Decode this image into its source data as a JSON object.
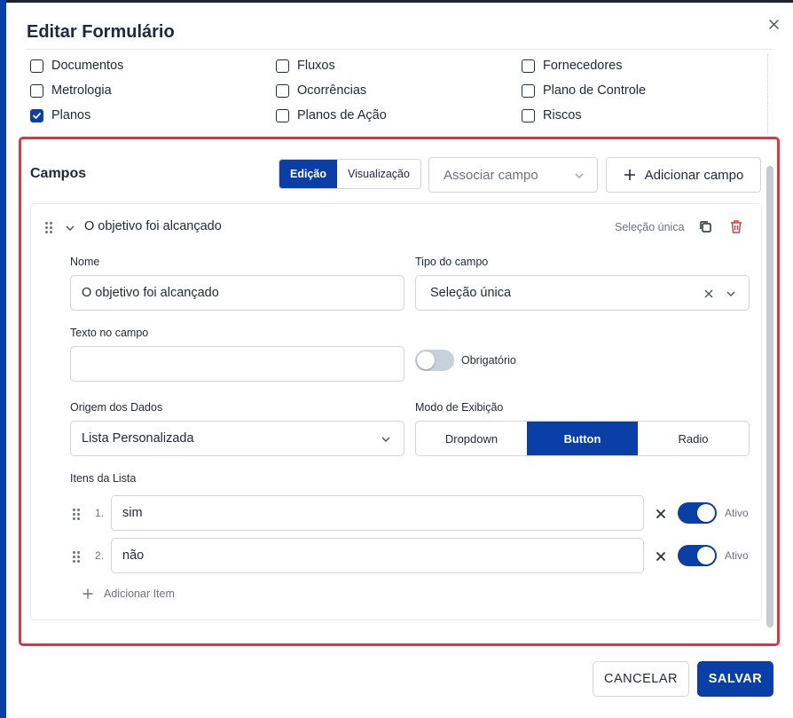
{
  "dialog": {
    "title": "Editar Formulário"
  },
  "modules": [
    {
      "label": "Documentos",
      "checked": false
    },
    {
      "label": "Fluxos",
      "checked": false
    },
    {
      "label": "Fornecedores",
      "checked": false
    },
    {
      "label": "Metrologia",
      "checked": false
    },
    {
      "label": "Ocorrências",
      "checked": false
    },
    {
      "label": "Plano de Controle",
      "checked": false
    },
    {
      "label": "Planos",
      "checked": true
    },
    {
      "label": "Planos de Ação",
      "checked": false
    },
    {
      "label": "Riscos",
      "checked": false
    }
  ],
  "campos": {
    "title": "Campos",
    "view_tabs": [
      "Edição",
      "Visualização"
    ],
    "active_tab": "Edição",
    "associar_placeholder": "Associar campo",
    "adicionar_label": "Adicionar campo"
  },
  "field": {
    "header_title": "O objetivo foi alcançado",
    "type_badge": "Seleção única",
    "nome_label": "Nome",
    "nome_value": "O objetivo foi alcançado",
    "tipo_label": "Tipo do campo",
    "tipo_value": "Seleção única",
    "texto_label": "Texto no campo",
    "texto_value": "",
    "obrigatorio_label": "Obrigatório",
    "obrigatorio_on": false,
    "origem_label": "Origem dos Dados",
    "origem_value": "Lista Personalizada",
    "modo_label": "Modo de Exibição",
    "modos": [
      "Dropdown",
      "Button",
      "Radio"
    ],
    "modo_active": "Button",
    "itens_label": "Itens da Lista",
    "items": [
      {
        "num": "1.",
        "value": "sim",
        "status": "Ativo",
        "active": true
      },
      {
        "num": "2.",
        "value": "não",
        "status": "Ativo",
        "active": true
      }
    ],
    "add_item_label": "Adicionar Item"
  },
  "footer": {
    "cancel": "CANCELAR",
    "save": "SALVAR"
  },
  "colors": {
    "primary": "#0b3fa8",
    "danger": "#dc3545",
    "border": "#d1d5db"
  }
}
